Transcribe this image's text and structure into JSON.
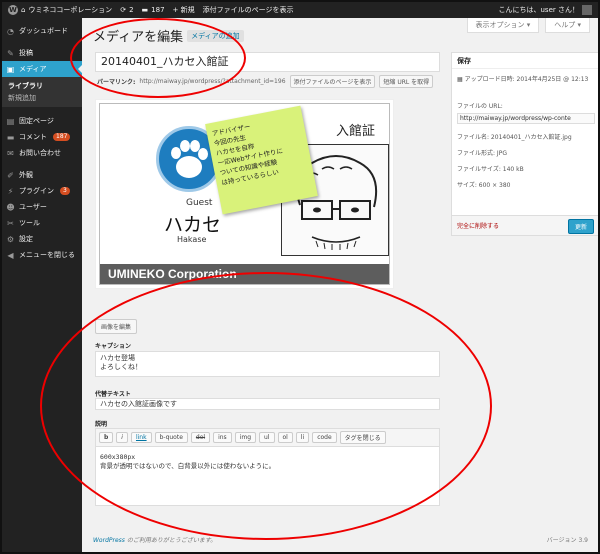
{
  "adminbar": {
    "site_name": "ウミネココーポレーション",
    "comments_count": "187",
    "new_label": "+ 新規",
    "view_attachment": "添付ファイルのページを表示",
    "greeting": "こんにちは、user さん！"
  },
  "screen_tabs": {
    "options": "表示オプション ▾",
    "help": "ヘルプ ▾"
  },
  "sidebar": {
    "dashboard": "ダッシュボード",
    "posts": "投稿",
    "media": "メディア",
    "library": "ライブラリ",
    "add_new": "新規追加",
    "pages": "固定ページ",
    "comments": "コメント",
    "comments_badge": "187",
    "contact": "お問い合わせ",
    "appearance": "外観",
    "plugins": "プラグイン",
    "plugins_badge": "3",
    "users": "ユーザー",
    "tools": "ツール",
    "settings": "設定",
    "collapse": "メニューを閉じる"
  },
  "page": {
    "title": "メディアを編集",
    "add_new": "メディアの追加",
    "attachment_title": "20140401_ハカセ入館証",
    "permalink_label": "パーマリンク:",
    "permalink_url": "http://maiway.jp/wordpress/?attachment_id=196",
    "view_page_btn": "添付ファイルのページを表示",
    "shortlink_btn": "短縮 URL を取得",
    "edit_image_btn": "画像を編集"
  },
  "card": {
    "sticky_lines": [
      "アドバイザー",
      "今回の先生",
      "ハカセを自称",
      "一応Webサイト作りに",
      "ついての知識や経験",
      "は持っているらしい"
    ],
    "guest": "Guest",
    "name": "ハカセ",
    "romaji": "Hakase",
    "pass": "入館証",
    "company": "UMINEKO Corporation"
  },
  "fields": {
    "caption_label": "キャプション",
    "caption_lines": [
      "ハカセ登場",
      "よろしくね！"
    ],
    "alt_label": "代替テキスト",
    "alt_value": "ハカセの入館証画像です",
    "desc_label": "説明",
    "quicktags": [
      "b",
      "i",
      "link",
      "b-quote",
      "del",
      "ins",
      "img",
      "ul",
      "ol",
      "li",
      "code",
      "タグを閉じる"
    ],
    "desc_lines": [
      "600x380px",
      "背景が透明ではないので、白背景以外には使わないように。"
    ]
  },
  "publish": {
    "heading": "保存",
    "uploaded_label": "アップロード日時:",
    "uploaded_value": "2014年4月25日 @ 12:13",
    "file_url_label": "ファイルの URL:",
    "file_url": "http://maiway.jp/wordpress/wp-conte",
    "file_name": "ファイル名: 20140401_ハカセ入館証.jpg",
    "file_type": "ファイル形式: JPG",
    "file_size_label": "ファイルサイズ:",
    "file_size": "140 kB",
    "dimensions": "サイズ: 600 × 380",
    "delete": "完全に削除する",
    "update": "更新"
  },
  "footer": {
    "wordpress": "WordPress",
    "thanks": " のご利用ありがとうございます。",
    "version": "バージョン 3.9"
  },
  "colors": {
    "admin_dark": "#222222",
    "accent_blue": "#2ea2cc",
    "annotation_red": "#e00000",
    "sticky_note": "#d9f27a"
  }
}
